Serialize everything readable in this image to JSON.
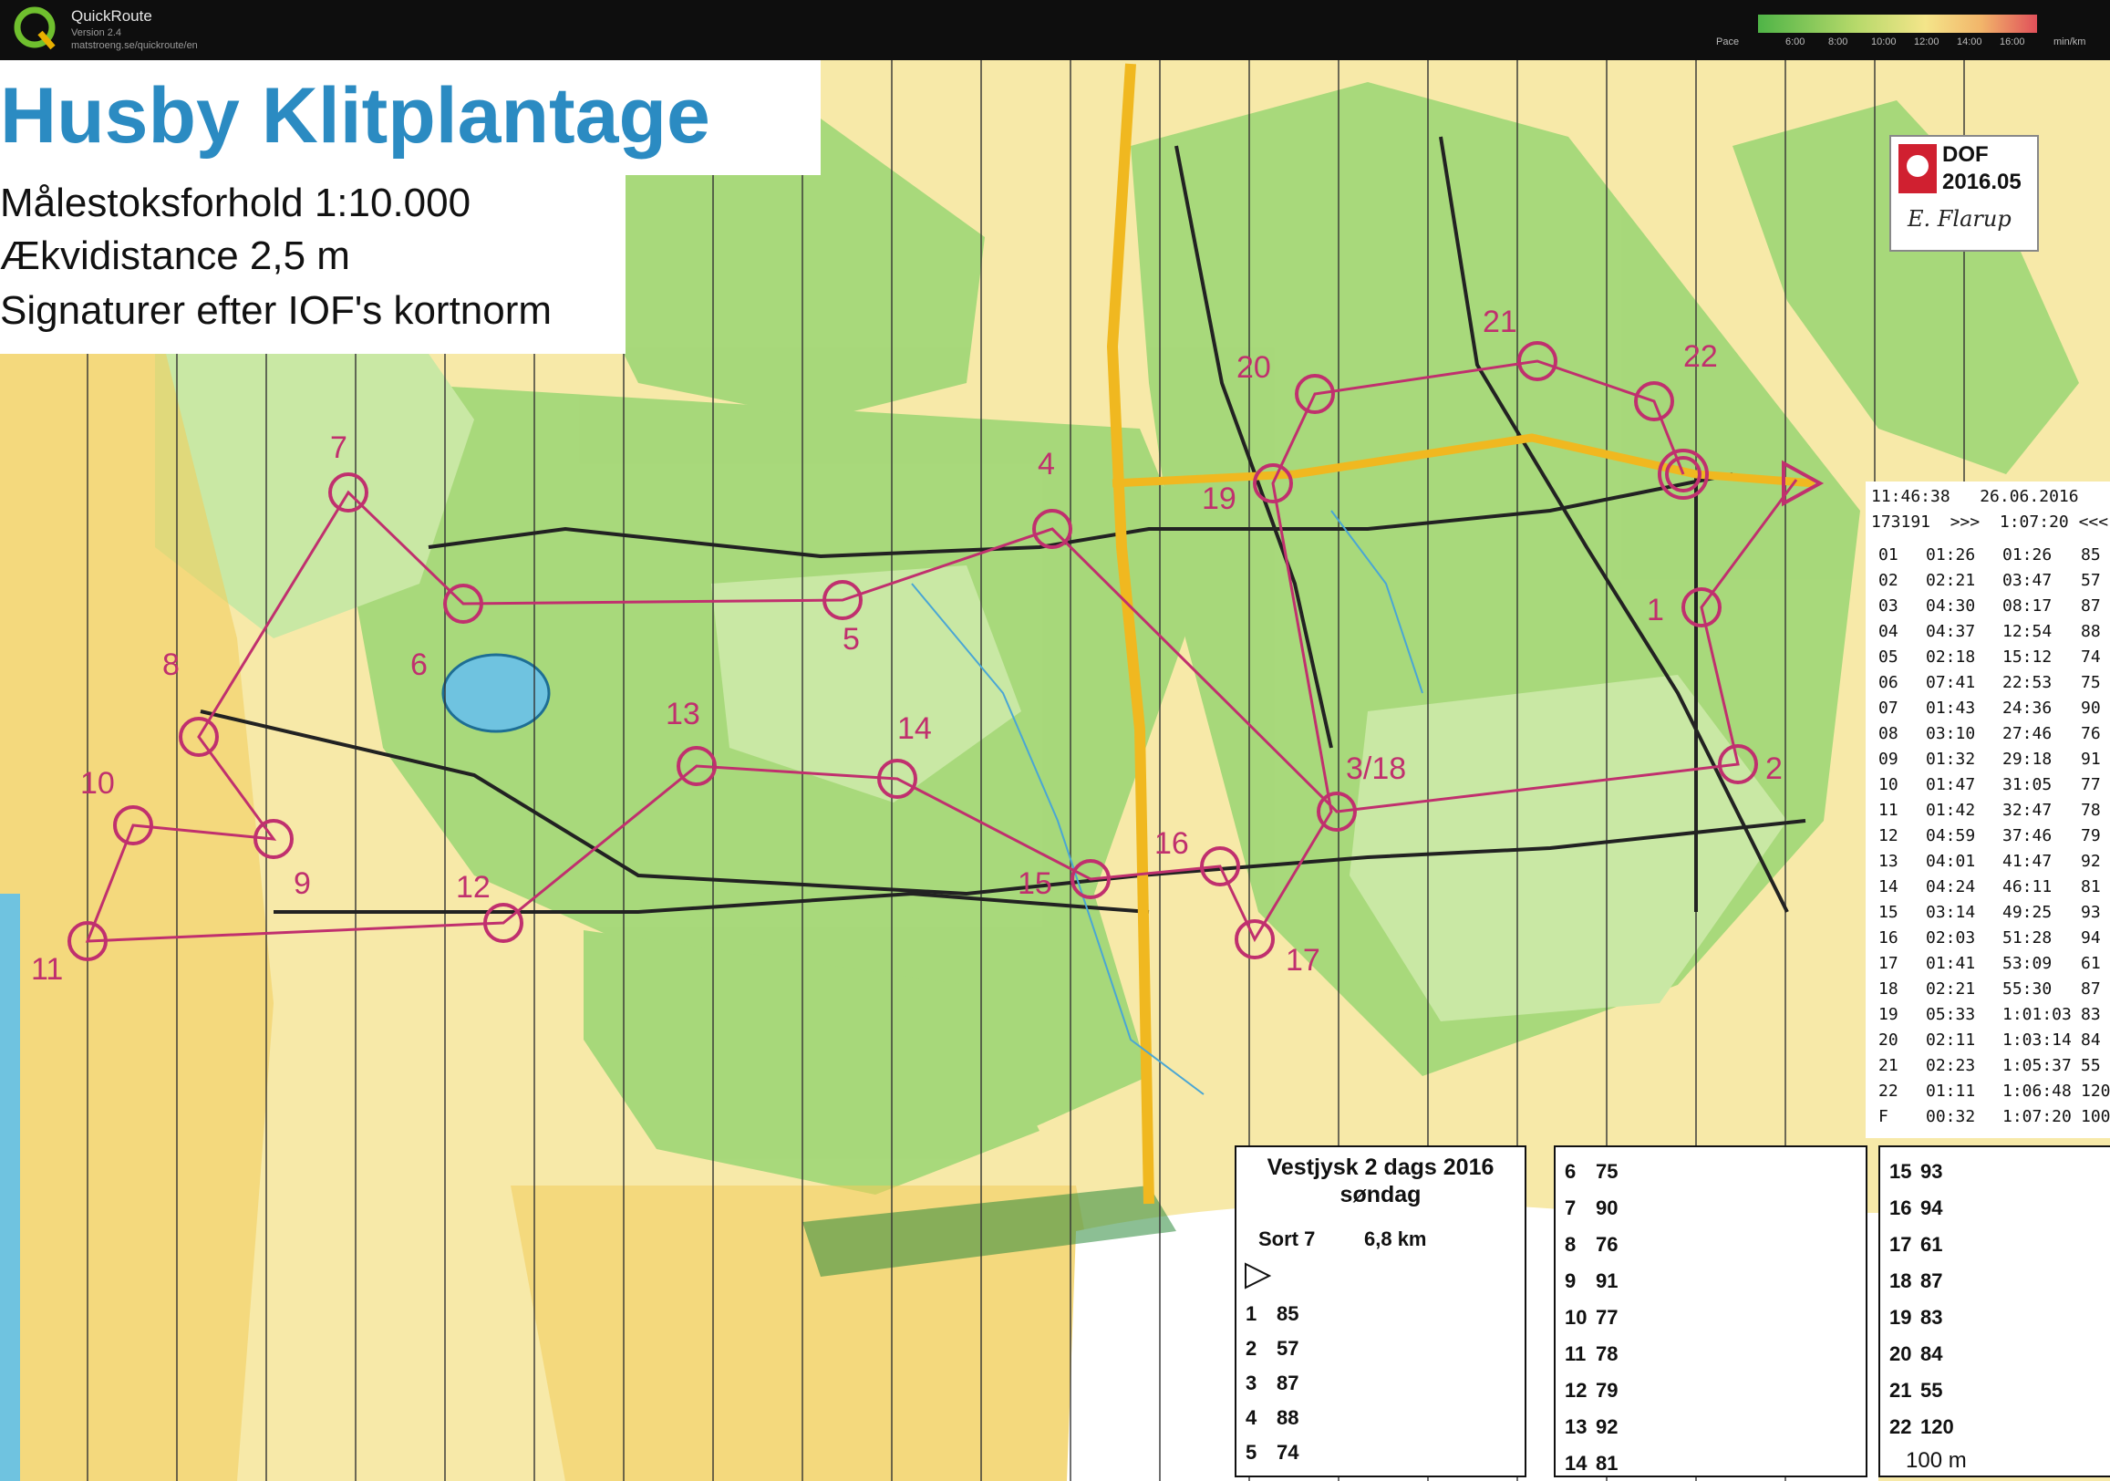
{
  "app": {
    "name": "QuickRoute",
    "version": "Version 2.4",
    "url": "matstroeng.se/quickroute/en"
  },
  "pace_scale": {
    "label": "Pace",
    "ticks": [
      "6:00",
      "8:00",
      "10:00",
      "12:00",
      "14:00",
      "16:00"
    ],
    "unit": "min/km"
  },
  "map": {
    "title": "Husby Klitplantage",
    "scale_line": "Målestoksforhold 1:10.000",
    "contour_line": "Ækvidistance 2,5 m",
    "symbols_line": "Signaturer efter IOF's kortnorm",
    "control_labels": [
      "1",
      "2",
      "3/18",
      "4",
      "5",
      "6",
      "7",
      "8",
      "9",
      "10",
      "11",
      "12",
      "13",
      "14",
      "15",
      "16",
      "17",
      "19",
      "20",
      "21",
      "22"
    ],
    "dof": {
      "line1": "DOF",
      "line2": "2016.05",
      "signature": "E. Flarup"
    }
  },
  "splits": {
    "timestamp": "11:46:38   26.06.2016",
    "runner": "173191  >>>  1:07:20 <<<",
    "rows": [
      [
        "01",
        "01:26",
        "01:26",
        "85"
      ],
      [
        "02",
        "02:21",
        "03:47",
        "57"
      ],
      [
        "03",
        "04:30",
        "08:17",
        "87"
      ],
      [
        "04",
        "04:37",
        "12:54",
        "88"
      ],
      [
        "05",
        "02:18",
        "15:12",
        "74"
      ],
      [
        "06",
        "07:41",
        "22:53",
        "75"
      ],
      [
        "07",
        "01:43",
        "24:36",
        "90"
      ],
      [
        "08",
        "03:10",
        "27:46",
        "76"
      ],
      [
        "09",
        "01:32",
        "29:18",
        "91"
      ],
      [
        "10",
        "01:47",
        "31:05",
        "77"
      ],
      [
        "11",
        "01:42",
        "32:47",
        "78"
      ],
      [
        "12",
        "04:59",
        "37:46",
        "79"
      ],
      [
        "13",
        "04:01",
        "41:47",
        "92"
      ],
      [
        "14",
        "04:24",
        "46:11",
        "81"
      ],
      [
        "15",
        "03:14",
        "49:25",
        "93"
      ],
      [
        "16",
        "02:03",
        "51:28",
        "94"
      ],
      [
        "17",
        "01:41",
        "53:09",
        "61"
      ],
      [
        "18",
        "02:21",
        "55:30",
        "87"
      ],
      [
        "19",
        "05:33",
        "1:01:03",
        "83"
      ],
      [
        "20",
        "02:11",
        "1:03:14",
        "84"
      ],
      [
        "21",
        "02:23",
        "1:05:37",
        "55"
      ],
      [
        "22",
        "01:11",
        "1:06:48",
        "120"
      ],
      [
        "F",
        "00:32",
        "1:07:20",
        "100"
      ]
    ]
  },
  "description": {
    "event": "Vestjysk 2 dags 2016",
    "day": "søndag",
    "class": "Sort 7",
    "length": "6,8 km",
    "col1": [
      [
        "1",
        "85"
      ],
      [
        "2",
        "57"
      ],
      [
        "3",
        "87"
      ],
      [
        "4",
        "88"
      ],
      [
        "5",
        "74"
      ]
    ],
    "col2": [
      [
        "6",
        "75"
      ],
      [
        "7",
        "90"
      ],
      [
        "8",
        "76"
      ],
      [
        "9",
        "91"
      ],
      [
        "10",
        "77"
      ],
      [
        "11",
        "78"
      ],
      [
        "12",
        "79"
      ],
      [
        "13",
        "92"
      ],
      [
        "14",
        "81"
      ]
    ],
    "col3": [
      [
        "15",
        "93"
      ],
      [
        "16",
        "94"
      ],
      [
        "17",
        "61"
      ],
      [
        "18",
        "87"
      ],
      [
        "19",
        "83"
      ],
      [
        "20",
        "84"
      ],
      [
        "21",
        "55"
      ],
      [
        "22",
        "120"
      ]
    ],
    "finish": "100 m"
  },
  "colors": {
    "title": "#2b8bc2",
    "course": "#c0306e",
    "green": "#8ed16a",
    "yellow": "#f6d877"
  }
}
